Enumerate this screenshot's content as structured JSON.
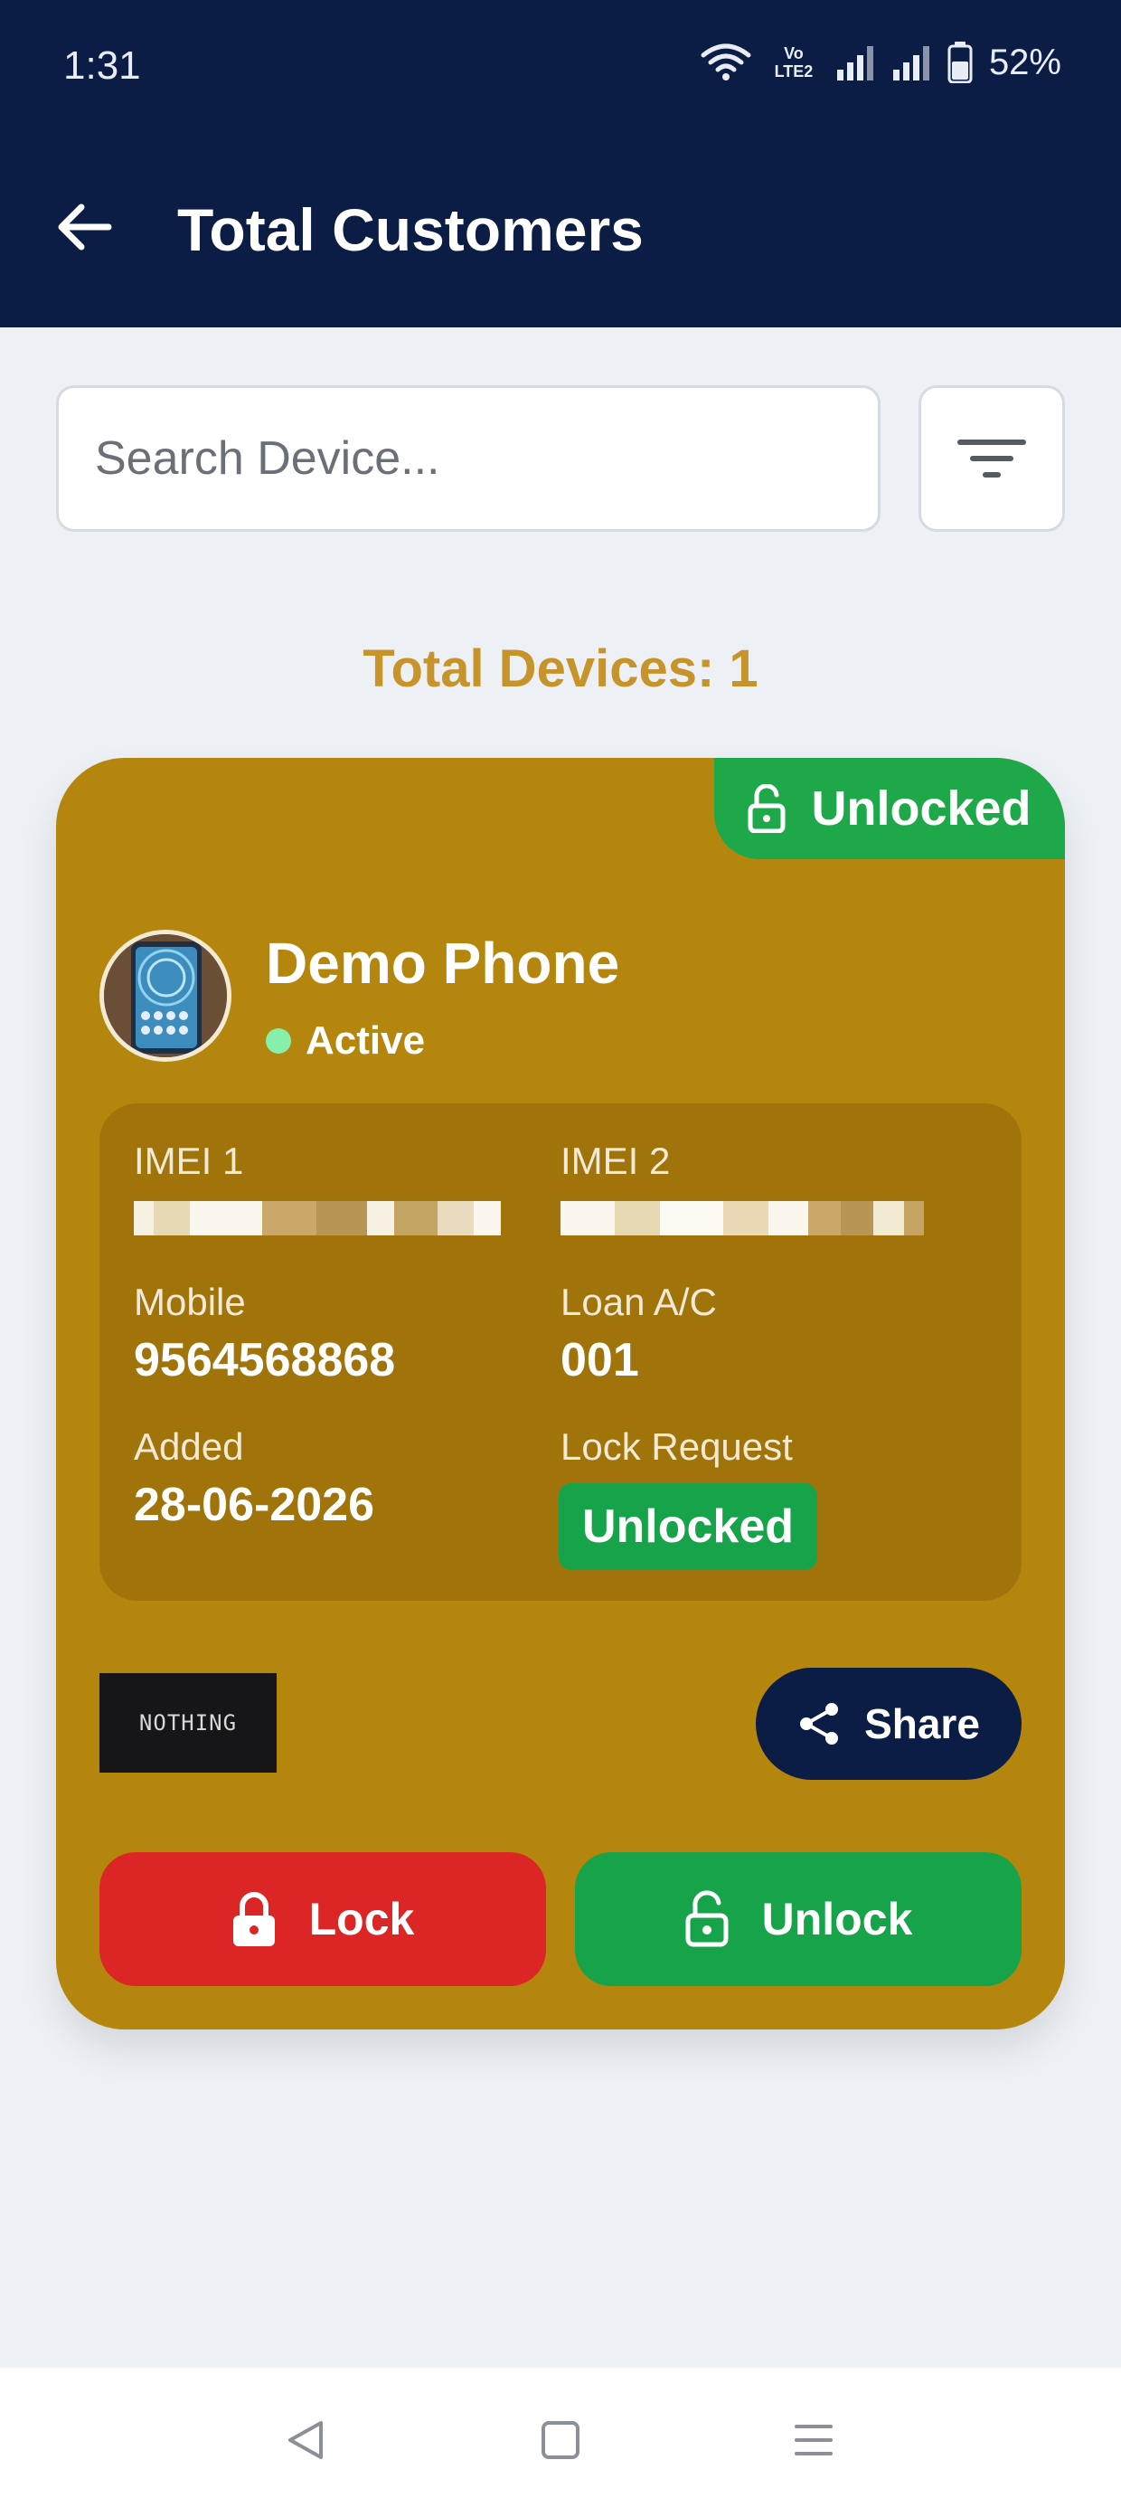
{
  "status_bar": {
    "time": "1:31",
    "network_label": "Vo LTE2",
    "battery": "52%",
    "icons": [
      "wifi-icon",
      "volte-icon",
      "signal-icon",
      "signal-icon",
      "battery-icon"
    ]
  },
  "header": {
    "title": "Total Customers",
    "back_icon": "arrow-left-icon"
  },
  "search": {
    "placeholder": "Search Device...",
    "value": ""
  },
  "filter_icon": "filter-icon",
  "summary": {
    "total_devices": "Total Devices: 1"
  },
  "device_card": {
    "corner_badge": "Unlocked",
    "name": "Demo Phone",
    "status": "Active",
    "imei1_label": "IMEI 1",
    "imei2_label": "IMEI 2",
    "mobile_label": "Mobile",
    "mobile_value": "9564568868",
    "loan_label": "Loan A/C",
    "loan_value": "001",
    "added_label": "Added",
    "added_value": "28-06-2026",
    "lock_request_label": "Lock Request",
    "lock_request_value": "Unlocked",
    "brand_logo_text": "NOTHING",
    "share_label": "Share",
    "lock_label": "Lock",
    "unlock_label": "Unlock"
  },
  "colors": {
    "header_bg": "#0b1d44",
    "card_bg": "#b5860d",
    "accent_gold": "#c6942a",
    "success": "#16a34a",
    "danger": "#dc2626"
  }
}
